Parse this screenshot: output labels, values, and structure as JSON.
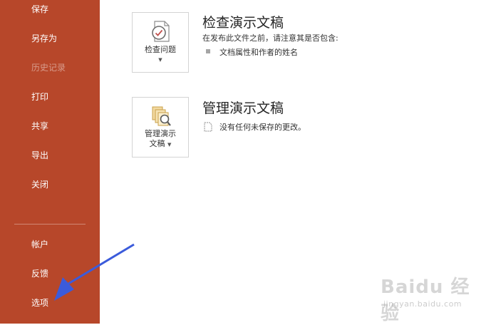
{
  "theme": {
    "accent": "#b7472a",
    "arrow_color": "#3b5bdb"
  },
  "sidebar": {
    "items": [
      {
        "label": "保存",
        "enabled": true
      },
      {
        "label": "另存为",
        "enabled": true
      },
      {
        "label": "历史记录",
        "enabled": false
      },
      {
        "label": "打印",
        "enabled": true
      },
      {
        "label": "共享",
        "enabled": true
      },
      {
        "label": "导出",
        "enabled": true
      },
      {
        "label": "关闭",
        "enabled": true
      }
    ],
    "bottom_items": [
      {
        "label": "帐户"
      },
      {
        "label": "反馈"
      },
      {
        "label": "选项"
      }
    ]
  },
  "inspect": {
    "button_label": "检查问题",
    "icon": "inspect-document-icon",
    "title": "检查演示文稿",
    "description": "在发布此文件之前，请注意其是否包含:",
    "bullets": [
      "文档属性和作者的姓名"
    ]
  },
  "manage": {
    "button_label_line1": "管理演示",
    "button_label_line2": "文稿",
    "icon": "manage-versions-icon",
    "title": "管理演示文稿",
    "status_text": "没有任何未保存的更改。"
  },
  "watermark": {
    "main": "Baidu 经验",
    "sub": "jingyan.baidu.com"
  }
}
